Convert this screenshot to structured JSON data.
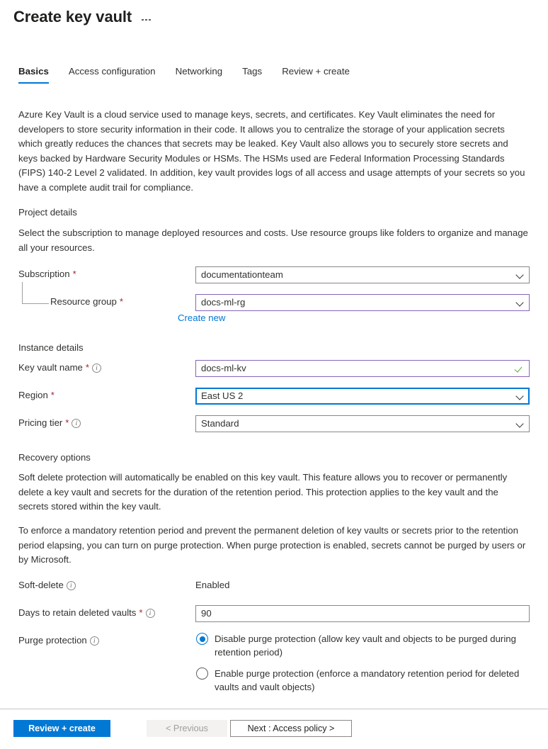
{
  "header": {
    "title": "Create key vault",
    "more_menu": "…"
  },
  "tabs": [
    {
      "label": "Basics",
      "active": true
    },
    {
      "label": "Access configuration",
      "active": false
    },
    {
      "label": "Networking",
      "active": false
    },
    {
      "label": "Tags",
      "active": false
    },
    {
      "label": "Review + create",
      "active": false
    }
  ],
  "intro": "Azure Key Vault is a cloud service used to manage keys, secrets, and certificates. Key Vault eliminates the need for developers to store security information in their code. It allows you to centralize the storage of your application secrets which greatly reduces the chances that secrets may be leaked. Key Vault also allows you to securely store secrets and keys backed by Hardware Security Modules or HSMs. The HSMs used are Federal Information Processing Standards (FIPS) 140-2 Level 2 validated. In addition, key vault provides logs of all access and usage attempts of your secrets so you have a complete audit trail for compliance.",
  "project_details": {
    "heading": "Project details",
    "description": "Select the subscription to manage deployed resources and costs. Use resource groups like folders to organize and manage all your resources.",
    "subscription": {
      "label": "Subscription",
      "required": "*",
      "value": "documentationteam",
      "control": "dropdown"
    },
    "resource_group": {
      "label": "Resource group",
      "required": "*",
      "value": "docs-ml-rg",
      "control": "dropdown",
      "create_new_link": "Create new"
    }
  },
  "instance_details": {
    "heading": "Instance details",
    "key_vault_name": {
      "label": "Key vault name",
      "required": "*",
      "value": "docs-ml-kv",
      "control": "textbox",
      "validation": "valid"
    },
    "region": {
      "label": "Region",
      "required": "*",
      "value": "East US 2",
      "control": "dropdown",
      "state": "focused"
    },
    "pricing_tier": {
      "label": "Pricing tier",
      "required": "*",
      "value": "Standard",
      "control": "dropdown"
    }
  },
  "recovery_options": {
    "heading": "Recovery options",
    "paragraph_1": "Soft delete protection will automatically be enabled on this key vault. This feature allows you to recover or permanently delete a key vault and secrets for the duration of the retention period. This protection applies to the key vault and the secrets stored within the key vault.",
    "paragraph_2": "To enforce a mandatory retention period and prevent the permanent deletion of key vaults or secrets prior to the retention period elapsing, you can turn on purge protection. When purge protection is enabled, secrets cannot be purged by users or by Microsoft.",
    "soft_delete": {
      "label": "Soft-delete",
      "value": "Enabled"
    },
    "days_to_retain": {
      "label": "Days to retain deleted vaults",
      "required": "*",
      "value": "90",
      "control": "textbox"
    },
    "purge_protection": {
      "label": "Purge protection",
      "options": [
        {
          "label": "Disable purge protection (allow key vault and objects to be purged during retention period)",
          "selected": true
        },
        {
          "label": "Enable purge protection (enforce a mandatory retention period for deleted vaults and vault objects)",
          "selected": false
        }
      ]
    }
  },
  "footer": {
    "review_create": "Review + create",
    "previous": "< Previous",
    "next": "Next : Access policy >"
  },
  "colors": {
    "accent": "#0078d4",
    "required": "#a4262c",
    "modified_border": "#8764b8",
    "valid_check": "#5aa82e",
    "link": "#0078d4",
    "text": "#323130"
  }
}
